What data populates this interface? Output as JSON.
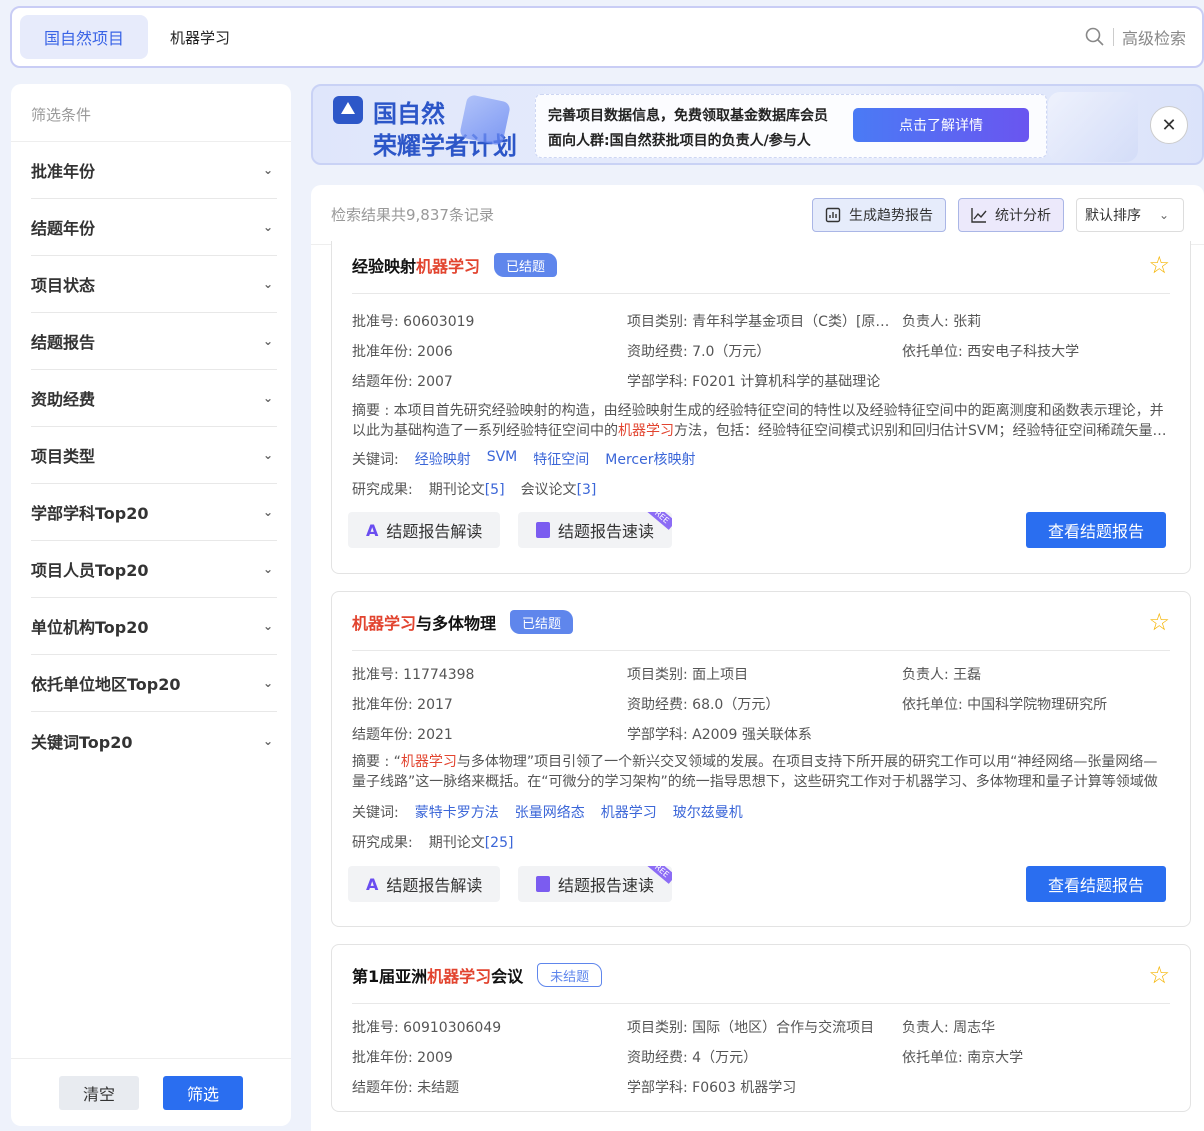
{
  "search": {
    "tab": "国自然项目",
    "query": "机器学习",
    "advanced": "高级检索"
  },
  "sidebar": {
    "title": "筛选条件",
    "filters": [
      "批准年份",
      "结题年份",
      "项目状态",
      "结题报告",
      "资助经费",
      "项目类型",
      "学部学科Top20",
      "项目人员Top20",
      "单位机构Top20",
      "依托单位地区Top20",
      "关键词Top20"
    ],
    "clear": "清空",
    "apply": "筛选"
  },
  "banner": {
    "title1": "国自然",
    "title2": "荣耀学者计划",
    "line1": "完善项目数据信息，免费领取基金数据库会员",
    "line2": "面向人群:国自然获批项目的负责人/参与人",
    "cta": "点击了解详情"
  },
  "results": {
    "count": "检索结果共9,837条记录",
    "trend": "生成趋势报告",
    "stats": "统计分析",
    "sort": "默认排序"
  },
  "labels": {
    "keywords": "关键词:",
    "outputs": "研究成果:",
    "interpret": "结题报告解读",
    "quick": "结题报告速读",
    "view": "查看结题报告"
  },
  "cards": [
    {
      "title_a": "经验映射",
      "title_hl": "机器学习",
      "title_b": "",
      "status": "已结题",
      "approval": "批准号: 60603019",
      "category": "项目类别: 青年科学基金项目（C类）[原…",
      "leader": "负责人: 张莉",
      "year": "批准年份: 2006",
      "fund": "资助经费: 7.0（万元）",
      "unit": "依托单位: 西安电子科技大学",
      "end": "结题年份: 2007",
      "subject": "学部学科: F0201 计算机科学的基础理论",
      "abstract_a": "摘要 : 本项目首先研究经验映射的构造，由经验映射生成的经验特征空间的特性以及经验特征空间中的距离测度和函数表示理论，并以此为基础构造了一系列经验特征空间中的",
      "abstract_hl": "机器学习",
      "abstract_b": "方法，包括：经验特征空间模式识别和回归估计SVM；经验特征空间稀疏矢量…",
      "keywords": [
        "经验映射",
        "SVM",
        "特征空间",
        "Mercer核映射"
      ],
      "out1": "期刊论文",
      "out1n": "[5]",
      "out2": "会议论文",
      "out2n": "[3]"
    },
    {
      "title_a": "",
      "title_hl": "机器学习",
      "title_b": "与多体物理",
      "status": "已结题",
      "approval": "批准号: 11774398",
      "category": "项目类别: 面上项目",
      "leader": "负责人: 王磊",
      "year": "批准年份: 2017",
      "fund": "资助经费: 68.0（万元）",
      "unit": "依托单位: 中国科学院物理研究所",
      "end": "结题年份: 2021",
      "subject": "学部学科: A2009 强关联体系",
      "abstract_a": "摘要 : “",
      "abstract_hl": "机器学习",
      "abstract_b": "与多体物理”项目引领了一个新兴交叉领域的发展。在项目支持下所开展的研究工作可以用“神经网络—张量网络—量子线路”这一脉络来概括。在“可微分的学习架构”的统一指导思想下，这些研究工作对于机器学习、多体物理和量子计算等领域做出…",
      "keywords": [
        "蒙特卡罗方法",
        "张量网络态",
        "机器学习",
        "玻尔兹曼机"
      ],
      "out1": "期刊论文",
      "out1n": "[25]"
    },
    {
      "title_a": "第1届亚洲",
      "title_hl": "机器学习",
      "title_b": "会议",
      "status": "未结题",
      "approval": "批准号: 60910306049",
      "category": "项目类别: 国际（地区）合作与交流项目",
      "leader": "负责人: 周志华",
      "year": "批准年份: 2009",
      "fund": "资助经费: 4（万元）",
      "unit": "依托单位: 南京大学",
      "end": "结题年份: 未结题",
      "subject": "学部学科: F0603 机器学习"
    }
  ]
}
